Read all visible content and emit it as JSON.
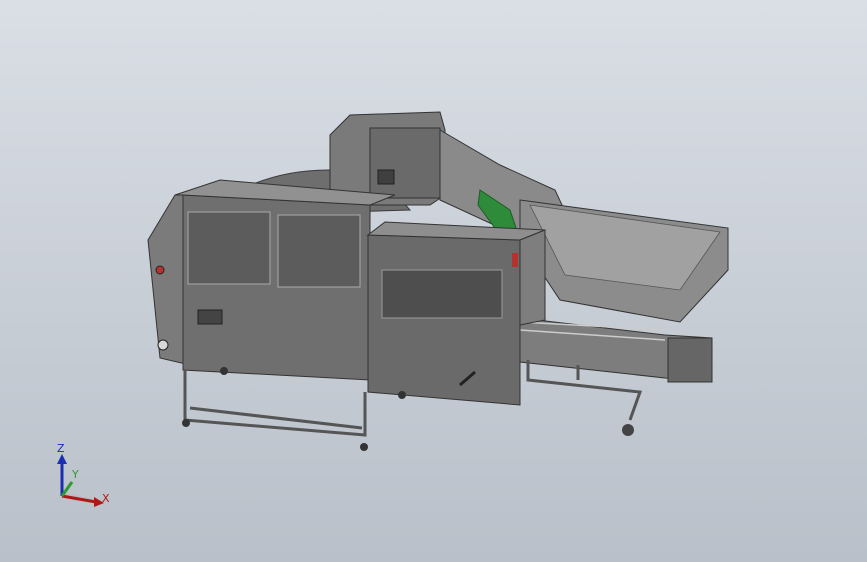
{
  "viewport": {
    "background_top": "#dadfe6",
    "background_bottom": "#b9c0c9"
  },
  "model": {
    "accent_green": "#2e8b3a",
    "accent_red": "#b5322e",
    "steel_light": "#8e8e8e",
    "steel_dark": "#5a5a5a"
  },
  "triad": {
    "x_label": "X",
    "y_label": "Y",
    "z_label": "Z",
    "x_color": "#b01818",
    "y_color": "#2e9a2e",
    "z_color": "#1a2fb0"
  }
}
